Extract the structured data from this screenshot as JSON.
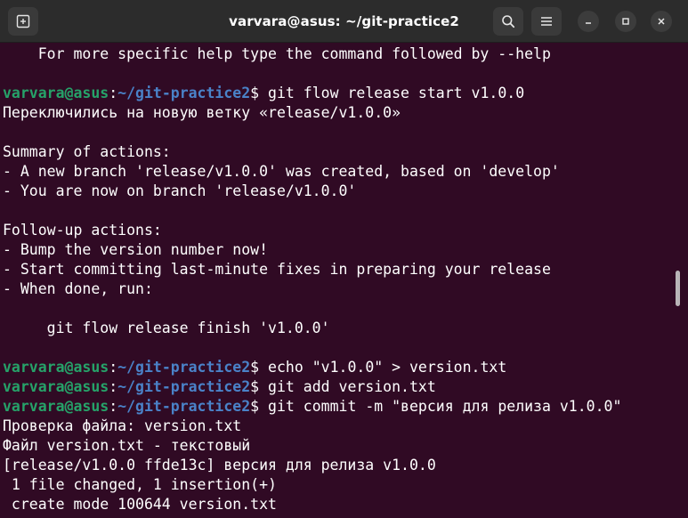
{
  "window": {
    "title": "varvara@asus: ~/git-practice2"
  },
  "icons": {
    "new_tab": "new-tab-icon",
    "search": "search-icon",
    "menu": "hamburger-menu-icon",
    "minimize": "minimize-icon",
    "maximize": "maximize-icon",
    "close": "close-icon"
  },
  "colors": {
    "background": "#300a24",
    "titlebar": "#2c2c2c",
    "prompt_user": "#26a269",
    "prompt_path": "#4a82c8",
    "text": "#ffffff"
  },
  "terminal": {
    "lines": [
      {
        "type": "text",
        "text": "    For more specific help type the command followed by --help"
      },
      {
        "type": "text",
        "text": ""
      },
      {
        "type": "prompt",
        "user": "varvara@asus",
        "sep": ":",
        "path": "~/git-practice2",
        "dollar": "$ ",
        "cmd": "git flow release start v1.0.0"
      },
      {
        "type": "text",
        "text": "Переключились на новую ветку «release/v1.0.0»"
      },
      {
        "type": "text",
        "text": ""
      },
      {
        "type": "text",
        "text": "Summary of actions:"
      },
      {
        "type": "text",
        "text": "- A new branch 'release/v1.0.0' was created, based on 'develop'"
      },
      {
        "type": "text",
        "text": "- You are now on branch 'release/v1.0.0'"
      },
      {
        "type": "text",
        "text": ""
      },
      {
        "type": "text",
        "text": "Follow-up actions:"
      },
      {
        "type": "text",
        "text": "- Bump the version number now!"
      },
      {
        "type": "text",
        "text": "- Start committing last-minute fixes in preparing your release"
      },
      {
        "type": "text",
        "text": "- When done, run:"
      },
      {
        "type": "text",
        "text": ""
      },
      {
        "type": "text",
        "text": "     git flow release finish 'v1.0.0'"
      },
      {
        "type": "text",
        "text": ""
      },
      {
        "type": "prompt",
        "user": "varvara@asus",
        "sep": ":",
        "path": "~/git-practice2",
        "dollar": "$ ",
        "cmd": "echo \"v1.0.0\" > version.txt"
      },
      {
        "type": "prompt",
        "user": "varvara@asus",
        "sep": ":",
        "path": "~/git-practice2",
        "dollar": "$ ",
        "cmd": "git add version.txt"
      },
      {
        "type": "prompt",
        "user": "varvara@asus",
        "sep": ":",
        "path": "~/git-practice2",
        "dollar": "$ ",
        "cmd": "git commit -m \"версия для релиза v1.0.0\""
      },
      {
        "type": "text",
        "text": "Проверка файла: version.txt"
      },
      {
        "type": "text",
        "text": "Файл version.txt - текстовый"
      },
      {
        "type": "text",
        "text": "[release/v1.0.0 ffde13c] версия для релиза v1.0.0"
      },
      {
        "type": "text",
        "text": " 1 file changed, 1 insertion(+)"
      },
      {
        "type": "text",
        "text": " create mode 100644 version.txt"
      }
    ]
  }
}
